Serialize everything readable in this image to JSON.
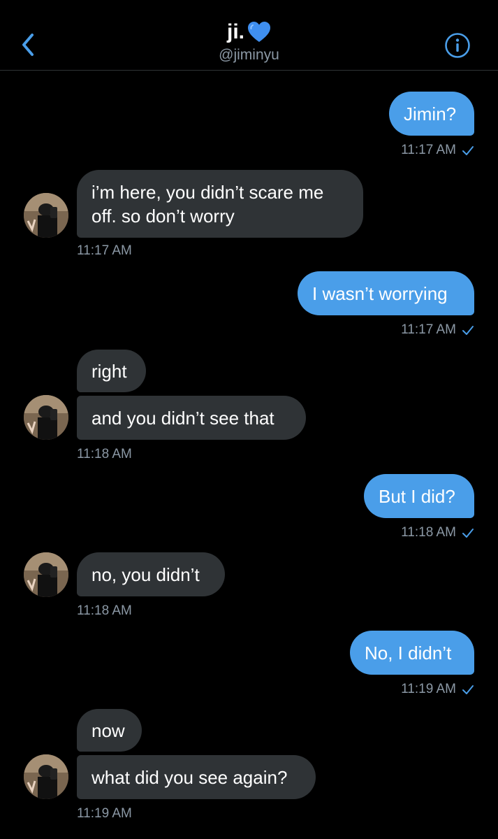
{
  "header": {
    "title": "ji.",
    "handle": "@jiminyu",
    "back_icon": "chevron-left-icon",
    "info_icon": "info-circle-icon",
    "heart_icon": "blue-heart-icon",
    "accent_color": "#4a9ee9"
  },
  "messages": [
    {
      "sender": "me",
      "text": "Jimin?",
      "time": "11:17 AM"
    },
    {
      "sender": "them",
      "text": "i’m here, you didn’t scare me off. so don’t worry",
      "time": "11:17 AM"
    },
    {
      "sender": "me",
      "text": "I wasn’t worrying",
      "time": "11:17 AM"
    },
    {
      "sender": "them",
      "text": "right"
    },
    {
      "sender": "them",
      "text": "and you didn’t see that",
      "time": "11:18 AM"
    },
    {
      "sender": "me",
      "text": "But I did?",
      "time": "11:18 AM"
    },
    {
      "sender": "them",
      "text": "no, you didn’t",
      "time": "11:18 AM"
    },
    {
      "sender": "me",
      "text": "No, I didn’t",
      "time": "11:19 AM"
    },
    {
      "sender": "them",
      "text": "now"
    },
    {
      "sender": "them",
      "text": "what did you see again?",
      "time": "11:19 AM"
    }
  ],
  "colors": {
    "outgoing_bubble": "#4a9ee9",
    "incoming_bubble": "#2f3336",
    "timestamp": "#8b98a5",
    "background": "#000000"
  }
}
